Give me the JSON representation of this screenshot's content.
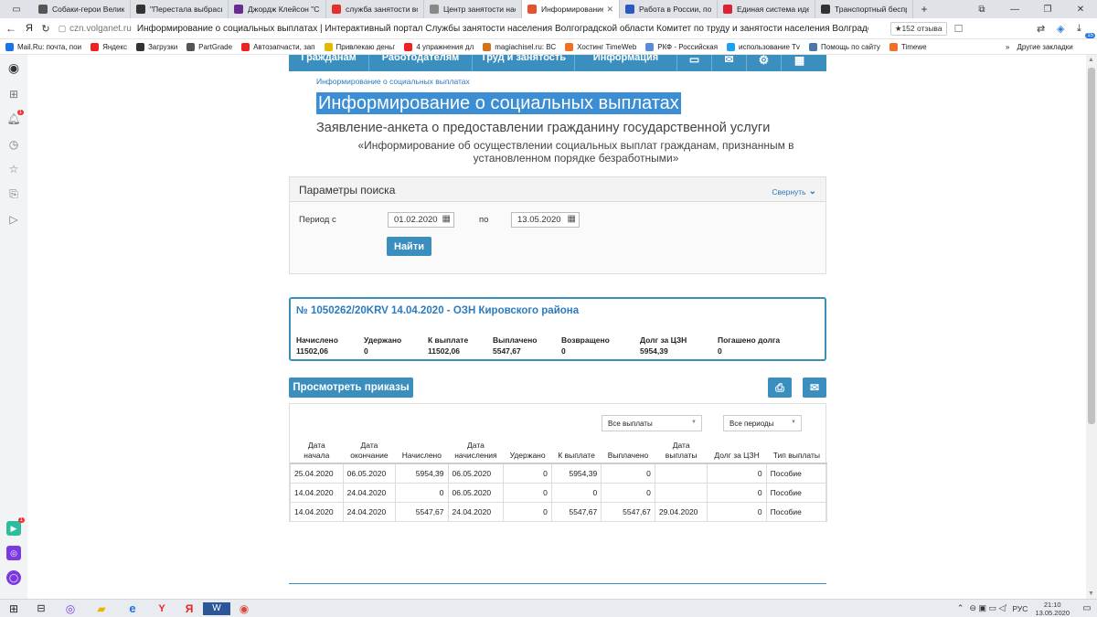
{
  "browser": {
    "tabs": [
      {
        "title": "Собаки-герои Велико",
        "color": "#555"
      },
      {
        "title": "\"Перестала выбрасыв",
        "color": "#333"
      },
      {
        "title": "Джордж Клейсон \"Са",
        "color": "#6a2c91"
      },
      {
        "title": "служба занятости вол",
        "color": "#e62e2e"
      },
      {
        "title": "Центр занятости насе",
        "color": "#888"
      },
      {
        "title": "Информирование",
        "color": "#e8532f"
      },
      {
        "title": "Работа в России, пои",
        "color": "#2b59c3"
      },
      {
        "title": "Единая система иден",
        "color": "#d23"
      },
      {
        "title": "Транспортный беспр",
        "color": "#333"
      }
    ],
    "active_tab_index": 5,
    "new_tab_label": "+",
    "domain": "czn.volganet.ru",
    "page_title": "Информирование о социальных выплатах | Интерактивный портал Службы занятости населения Волгоградской области Комитет по труду и занятости населения Волградс...",
    "reviews_badge": "★152 отзыва",
    "downloads_badge": "15",
    "bookmarks": [
      {
        "label": "Mail.Ru: почта, пои",
        "color": "#1a73e8"
      },
      {
        "label": "Яндекс",
        "color": "#e22"
      },
      {
        "label": "Загрузки",
        "color": "#333"
      },
      {
        "label": "PartGrade",
        "color": "#555"
      },
      {
        "label": "Автозапчасти, зап",
        "color": "#e22"
      },
      {
        "label": "Привлекаю деньг",
        "color": "#e5b800"
      },
      {
        "label": "4 упражнения дл",
        "color": "#e22"
      },
      {
        "label": "magiachisel.ru: ВС",
        "color": "#d0731b"
      },
      {
        "label": "Хостинг TimeWeb",
        "color": "#f36f21"
      },
      {
        "label": "РКФ - Российская",
        "color": "#5a8dd8"
      },
      {
        "label": "использование Tv",
        "color": "#1da1f2"
      },
      {
        "label": "Помощь по сайту",
        "color": "#4a76a8"
      },
      {
        "label": "Timewe",
        "color": "#f36f21"
      }
    ],
    "other_bookmarks": "Другие закладки",
    "more_bookmarks": "»"
  },
  "sidebar": {
    "notif_badge": "1",
    "app_badge": "1"
  },
  "nav": {
    "items": [
      "Гражданам",
      "Работодателям",
      "Труд и занятость",
      "Информация"
    ]
  },
  "breadcrumb": "Информирование о социальных выплатах",
  "heading": "Информирование о социальных выплатах",
  "subheading": "Заявление-анкета о предоставлении гражданину государственной услуги",
  "service_quote": "«Информирование об осуществлении социальных выплат гражданам, признанным в установленном порядке безработными»",
  "search": {
    "title": "Параметры поиска",
    "collapse_label": "Свернуть",
    "period_label": "Период с",
    "date_from": "01.02.2020",
    "to_label": "по",
    "date_to": "13.05.2020",
    "find_button": "Найти"
  },
  "summary": {
    "title": "№ 1050262/20KRV 14.04.2020 - ОЗН Кировского района",
    "columns": [
      {
        "label": "Начислено",
        "value": "11502,06"
      },
      {
        "label": "Удержано",
        "value": "0"
      },
      {
        "label": "К выплате",
        "value": "11502,06"
      },
      {
        "label": "Выплачено",
        "value": "5547,67"
      },
      {
        "label": "Возвращено",
        "value": "0"
      },
      {
        "label": "Долг за ЦЗН",
        "value": "5954,39"
      },
      {
        "label": "Погашено долга",
        "value": "0"
      }
    ]
  },
  "orders_button": "Просмотреть приказы",
  "payments": {
    "filter_payments": "Все выплаты",
    "filter_periods": "Все периоды",
    "headers": [
      [
        "Дата",
        "начала"
      ],
      [
        "Дата",
        "окончание"
      ],
      [
        "",
        "Начислено"
      ],
      [
        "Дата",
        "начисления"
      ],
      [
        "",
        "Удержано"
      ],
      [
        "",
        "К выплате"
      ],
      [
        "",
        "Выплачено"
      ],
      [
        "Дата",
        "выплаты"
      ],
      [
        "",
        "Долг за ЦЗН"
      ],
      [
        "",
        "Тип выплаты"
      ]
    ],
    "rows": [
      [
        "25.04.2020",
        "06.05.2020",
        "5954,39",
        "06.05.2020",
        "0",
        "5954,39",
        "0",
        "",
        "0",
        "Пособие"
      ],
      [
        "14.04.2020",
        "24.04.2020",
        "0",
        "06.05.2020",
        "0",
        "0",
        "0",
        "",
        "0",
        "Пособие"
      ],
      [
        "14.04.2020",
        "24.04.2020",
        "5547,67",
        "24.04.2020",
        "0",
        "5547,67",
        "5547,67",
        "29.04.2020",
        "0",
        "Пособие"
      ]
    ]
  },
  "taskbar": {
    "lang": "РУС",
    "time": "21:10",
    "date": "13.05.2020"
  }
}
